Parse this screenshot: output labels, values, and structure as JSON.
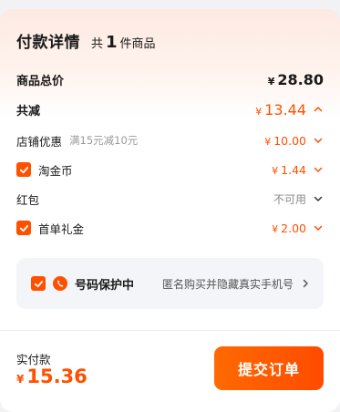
{
  "header": {
    "title": "付款详情",
    "count_prefix": "共",
    "count_value": "1",
    "count_suffix": "件商品"
  },
  "currency_symbol": "¥",
  "subtotal": {
    "label": "商品总价",
    "amount": "28.80"
  },
  "discount_total": {
    "label": "共减",
    "amount": "13.44"
  },
  "store_discount": {
    "label": "店铺优惠",
    "note": "满15元减10元",
    "amount": "10.00"
  },
  "taojin": {
    "label": "淘金币",
    "amount": "1.44",
    "checked": true
  },
  "red_packet": {
    "label": "红包",
    "status": "不可用"
  },
  "first_order_gift": {
    "label": "首单礼金",
    "amount": "2.00",
    "checked": true
  },
  "privacy": {
    "title": "号码保护中",
    "description": "匿名购买并隐藏真实手机号",
    "checked": true
  },
  "footer": {
    "pay_label": "实付款",
    "pay_amount": "15.36",
    "submit_label": "提交订单"
  },
  "colors": {
    "accent": "#ff5000",
    "background": "#f2f2f4",
    "panel": "#f3f5f9"
  }
}
